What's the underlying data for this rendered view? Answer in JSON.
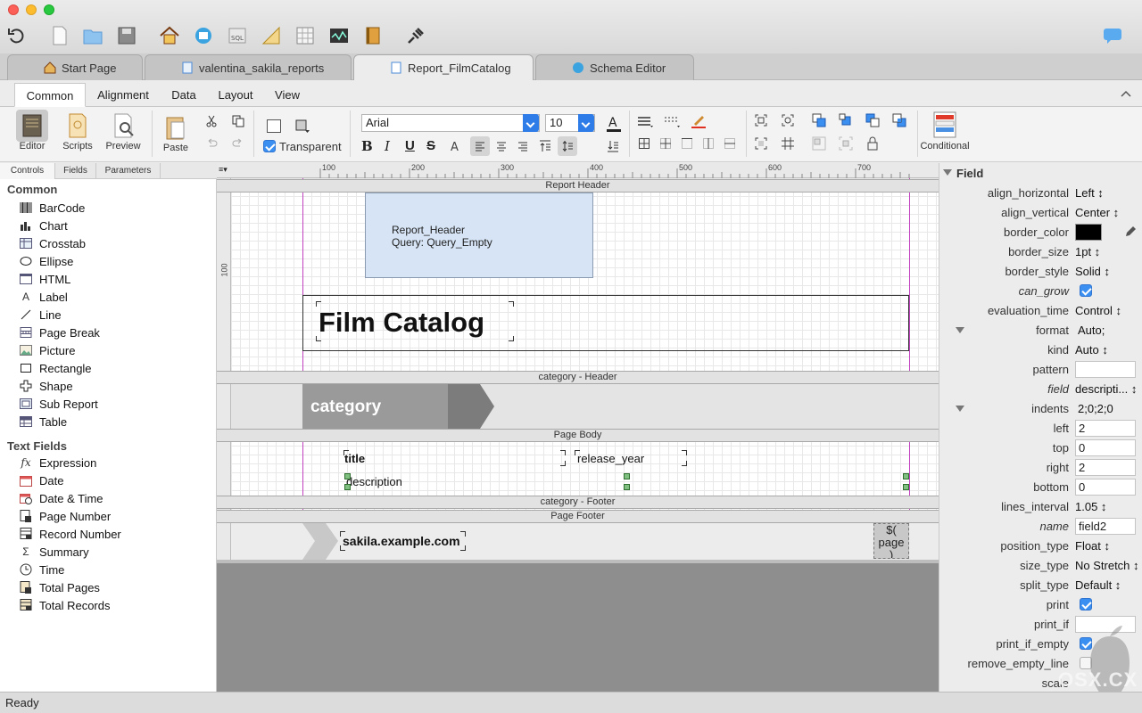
{
  "toolbar_top": {
    "icons": [
      "undo-icon",
      "new-doc-icon",
      "open-folder-icon",
      "save-icon",
      "home-icon",
      "schema-icon",
      "sql-icon",
      "ruler-icon",
      "table-icon",
      "chart-line-icon",
      "book-icon",
      "connection-plug-icon",
      "chat-bubble-icon"
    ]
  },
  "tabs": [
    {
      "label": "Start Page"
    },
    {
      "label": "valentina_sakila_reports"
    },
    {
      "label": "Report_FilmCatalog"
    },
    {
      "label": "Schema Editor"
    }
  ],
  "ribbon_tabs": [
    "Common",
    "Alignment",
    "Data",
    "Layout",
    "View"
  ],
  "toolbar": {
    "editor": "Editor",
    "scripts": "Scripts",
    "preview": "Preview",
    "paste": "Paste",
    "transparent": "Transparent",
    "font_name": "Arial",
    "font_size": "10",
    "conditional": "Conditional",
    "bold": "B",
    "italic": "I",
    "underline": "U",
    "strike": "S"
  },
  "sidebar": {
    "tabs": [
      "Controls",
      "Fields",
      "Parameters"
    ],
    "group1": "Common",
    "common_items": [
      "BarCode",
      "Chart",
      "Crosstab",
      "Ellipse",
      "HTML",
      "Label",
      "Line",
      "Page Break",
      "Picture",
      "Rectangle",
      "Shape",
      "Sub Report",
      "Table"
    ],
    "group2": "Text Fields",
    "text_items": [
      "Expression",
      "Date",
      "Date & Time",
      "Page Number",
      "Record Number",
      "Summary",
      "Time",
      "Total Pages",
      "Total Records"
    ]
  },
  "ruler": {
    "ticks": [
      "100",
      "200",
      "300",
      "400",
      "500",
      "600",
      "700"
    ],
    "left_tick": "100"
  },
  "report": {
    "bands": {
      "report_header": "Report Header",
      "category_header": "category - Header",
      "page_body": "Page Body",
      "category_footer": "category - Footer",
      "page_footer": "Page Footer"
    },
    "header_box_line1": "Report_Header",
    "header_box_line2": "Query: Query_Empty",
    "title": "Film Catalog",
    "category_label": "category",
    "field_title": "title",
    "field_release_year": "release_year",
    "field_description": "description",
    "footer_url": "sakila.example.com",
    "page_expr": "$(\npage\n)"
  },
  "properties": {
    "section": "Field",
    "rows": [
      {
        "label": "align_horizontal",
        "value": "Left ↕"
      },
      {
        "label": "align_vertical",
        "value": "Center ↕"
      },
      {
        "label": "border_color",
        "value": ""
      },
      {
        "label": "border_size",
        "value": "1pt ↕"
      },
      {
        "label": "border_style",
        "value": "Solid ↕"
      },
      {
        "label": "can_grow",
        "value": ""
      },
      {
        "label": "evaluation_time",
        "value": "Control ↕"
      },
      {
        "label": "format",
        "value": "Auto;"
      },
      {
        "label": "kind",
        "value": "Auto ↕"
      },
      {
        "label": "pattern",
        "value": ""
      },
      {
        "label": "field",
        "value": "descripti... ↕"
      },
      {
        "label": "indents",
        "value": "2;0;2;0"
      },
      {
        "label": "left",
        "value": "2"
      },
      {
        "label": "top",
        "value": "0"
      },
      {
        "label": "right",
        "value": "2"
      },
      {
        "label": "bottom",
        "value": "0"
      },
      {
        "label": "lines_interval",
        "value": "1.05 ↕"
      },
      {
        "label": "name",
        "value": "field2"
      },
      {
        "label": "position_type",
        "value": "Float ↕"
      },
      {
        "label": "size_type",
        "value": "No Stretch ↕"
      },
      {
        "label": "split_type",
        "value": "Default ↕"
      },
      {
        "label": "print",
        "value": ""
      },
      {
        "label": "print_if",
        "value": ""
      },
      {
        "label": "print_if_empty",
        "value": ""
      },
      {
        "label": "remove_empty_line",
        "value": ""
      },
      {
        "label": "scale",
        "value": ""
      }
    ]
  },
  "watermark": "OSX.CX",
  "status": "Ready",
  "colors": {
    "accent": "#2e7ce8",
    "band_header_bg": "#d6e4f5",
    "category_fill": "#9a9a9a"
  }
}
